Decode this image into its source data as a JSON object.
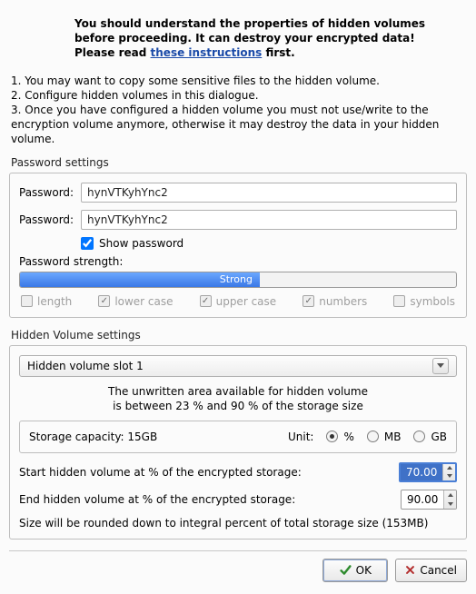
{
  "warning": {
    "line1": "You should understand the properties of hidden volumes before proceeding. It can destroy your encrypted data! Please read ",
    "link": "these instructions",
    "after": " first."
  },
  "instructions": {
    "l1": "1. You may want to copy some sensitive files to the hidden volume.",
    "l2": "2. Configure hidden volumes in this dialogue.",
    "l3": "3. Once you have configured a hidden volume you must not use/write to the encryption volume anymore, otherwise it may destroy the data in your hidden volume."
  },
  "pw": {
    "group": "Password settings",
    "label": "Password:",
    "value": "hynVTKyhYnc2",
    "show_label": "Show password",
    "show_checked": true,
    "strength_label": "Password strength:",
    "strength_text": "Strong",
    "strength_percent": 55,
    "criteria": {
      "length": {
        "label": "length",
        "on": false
      },
      "lower": {
        "label": "lower case",
        "on": true
      },
      "upper": {
        "label": "upper case",
        "on": true
      },
      "numbers": {
        "label": "numbers",
        "on": true
      },
      "symbols": {
        "label": "symbols",
        "on": false
      }
    }
  },
  "hv": {
    "group": "Hidden Volume settings",
    "slot": "Hidden volume slot 1",
    "info1": "The unwritten area available for hidden volume",
    "info2": "is between 23 % and 90 % of the storage size",
    "capacity_label": "Storage capacity: 15GB",
    "unit_label": "Unit:",
    "units": {
      "percent": "%",
      "mb": "MB",
      "gb": "GB",
      "selected": "percent"
    },
    "start_label": "Start hidden volume at % of the encrypted storage:",
    "start_value": "70.00",
    "end_label": "End hidden volume at % of the encrypted storage:",
    "end_value": "90.00",
    "round_note": "Size will be rounded down to integral percent of total storage size (153MB)"
  },
  "buttons": {
    "ok": "OK",
    "cancel": "Cancel"
  }
}
